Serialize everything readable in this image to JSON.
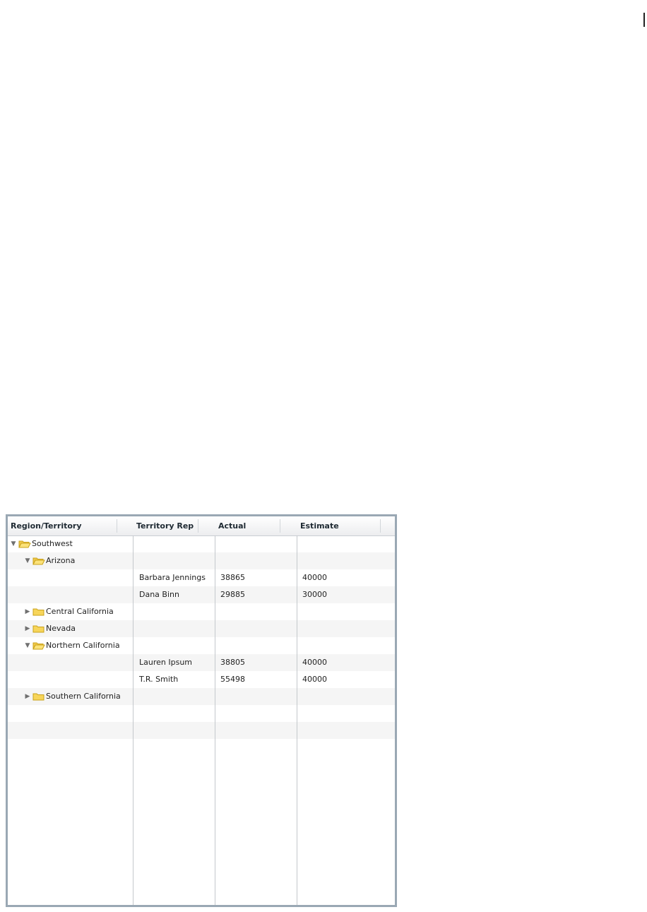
{
  "grid": {
    "columns": [
      "Region/Territory",
      "Territory Rep",
      "Actual",
      "Estimate"
    ],
    "rows": [
      {
        "level": 0,
        "expander": "expanded",
        "label": "Southwest",
        "rep": "",
        "actual": "",
        "estimate": ""
      },
      {
        "level": 1,
        "expander": "expanded",
        "label": "Arizona",
        "rep": "",
        "actual": "",
        "estimate": ""
      },
      {
        "level": -1,
        "label": "",
        "rep": "Barbara Jennings",
        "actual": "38865",
        "estimate": "40000"
      },
      {
        "level": -1,
        "label": "",
        "rep": "Dana Binn",
        "actual": "29885",
        "estimate": "30000"
      },
      {
        "level": 1,
        "expander": "collapsed",
        "label": "Central California",
        "rep": "",
        "actual": "",
        "estimate": ""
      },
      {
        "level": 1,
        "expander": "collapsed",
        "label": "Nevada",
        "rep": "",
        "actual": "",
        "estimate": ""
      },
      {
        "level": 1,
        "expander": "expanded",
        "label": "Northern California",
        "rep": "",
        "actual": "",
        "estimate": ""
      },
      {
        "level": -1,
        "label": "",
        "rep": "Lauren Ipsum",
        "actual": "38805",
        "estimate": "40000"
      },
      {
        "level": -1,
        "label": "",
        "rep": "T.R. Smith",
        "actual": "55498",
        "estimate": "40000"
      },
      {
        "level": 1,
        "expander": "collapsed",
        "label": "Southern California",
        "rep": "",
        "actual": "",
        "estimate": ""
      },
      {
        "level": -1,
        "label": "",
        "rep": "",
        "actual": "",
        "estimate": ""
      },
      {
        "level": -1,
        "label": "",
        "rep": "",
        "actual": "",
        "estimate": ""
      }
    ]
  },
  "icons": {
    "expanded": "triangle-down-icon",
    "collapsed": "triangle-right-icon",
    "folder_open": "folder-open-icon",
    "folder_closed": "folder-icon"
  },
  "colors": {
    "frame_border": "#9aa8b4",
    "folder_fill": "#f7d55a",
    "folder_stroke": "#c9a21a",
    "row_alt": "#f5f5f5"
  }
}
